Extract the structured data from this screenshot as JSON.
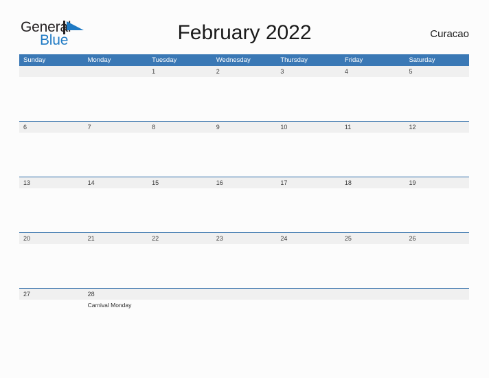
{
  "brand": {
    "name_part1": "General",
    "name_part2": "Blue",
    "flag_icon": "blue-triangle-flag-icon",
    "color_dark": "#231f20",
    "color_blue": "#1f7ac4"
  },
  "header": {
    "title": "February 2022",
    "location": "Curacao"
  },
  "calendar": {
    "header_color": "#3a78b5",
    "band_color": "#f0f0f0",
    "row_line_color": "#2d6ca8",
    "weekdays": [
      "Sunday",
      "Monday",
      "Tuesday",
      "Wednesday",
      "Thursday",
      "Friday",
      "Saturday"
    ],
    "weeks": [
      {
        "days": [
          {
            "num": "",
            "event": ""
          },
          {
            "num": "",
            "event": ""
          },
          {
            "num": "1",
            "event": ""
          },
          {
            "num": "2",
            "event": ""
          },
          {
            "num": "3",
            "event": ""
          },
          {
            "num": "4",
            "event": ""
          },
          {
            "num": "5",
            "event": ""
          }
        ]
      },
      {
        "days": [
          {
            "num": "6",
            "event": ""
          },
          {
            "num": "7",
            "event": ""
          },
          {
            "num": "8",
            "event": ""
          },
          {
            "num": "9",
            "event": ""
          },
          {
            "num": "10",
            "event": ""
          },
          {
            "num": "11",
            "event": ""
          },
          {
            "num": "12",
            "event": ""
          }
        ]
      },
      {
        "days": [
          {
            "num": "13",
            "event": ""
          },
          {
            "num": "14",
            "event": ""
          },
          {
            "num": "15",
            "event": ""
          },
          {
            "num": "16",
            "event": ""
          },
          {
            "num": "17",
            "event": ""
          },
          {
            "num": "18",
            "event": ""
          },
          {
            "num": "19",
            "event": ""
          }
        ]
      },
      {
        "days": [
          {
            "num": "20",
            "event": ""
          },
          {
            "num": "21",
            "event": ""
          },
          {
            "num": "22",
            "event": ""
          },
          {
            "num": "23",
            "event": ""
          },
          {
            "num": "24",
            "event": ""
          },
          {
            "num": "25",
            "event": ""
          },
          {
            "num": "26",
            "event": ""
          }
        ]
      },
      {
        "days": [
          {
            "num": "27",
            "event": ""
          },
          {
            "num": "28",
            "event": "Carnival Monday"
          },
          {
            "num": "",
            "event": ""
          },
          {
            "num": "",
            "event": ""
          },
          {
            "num": "",
            "event": ""
          },
          {
            "num": "",
            "event": ""
          },
          {
            "num": "",
            "event": ""
          }
        ]
      }
    ]
  }
}
